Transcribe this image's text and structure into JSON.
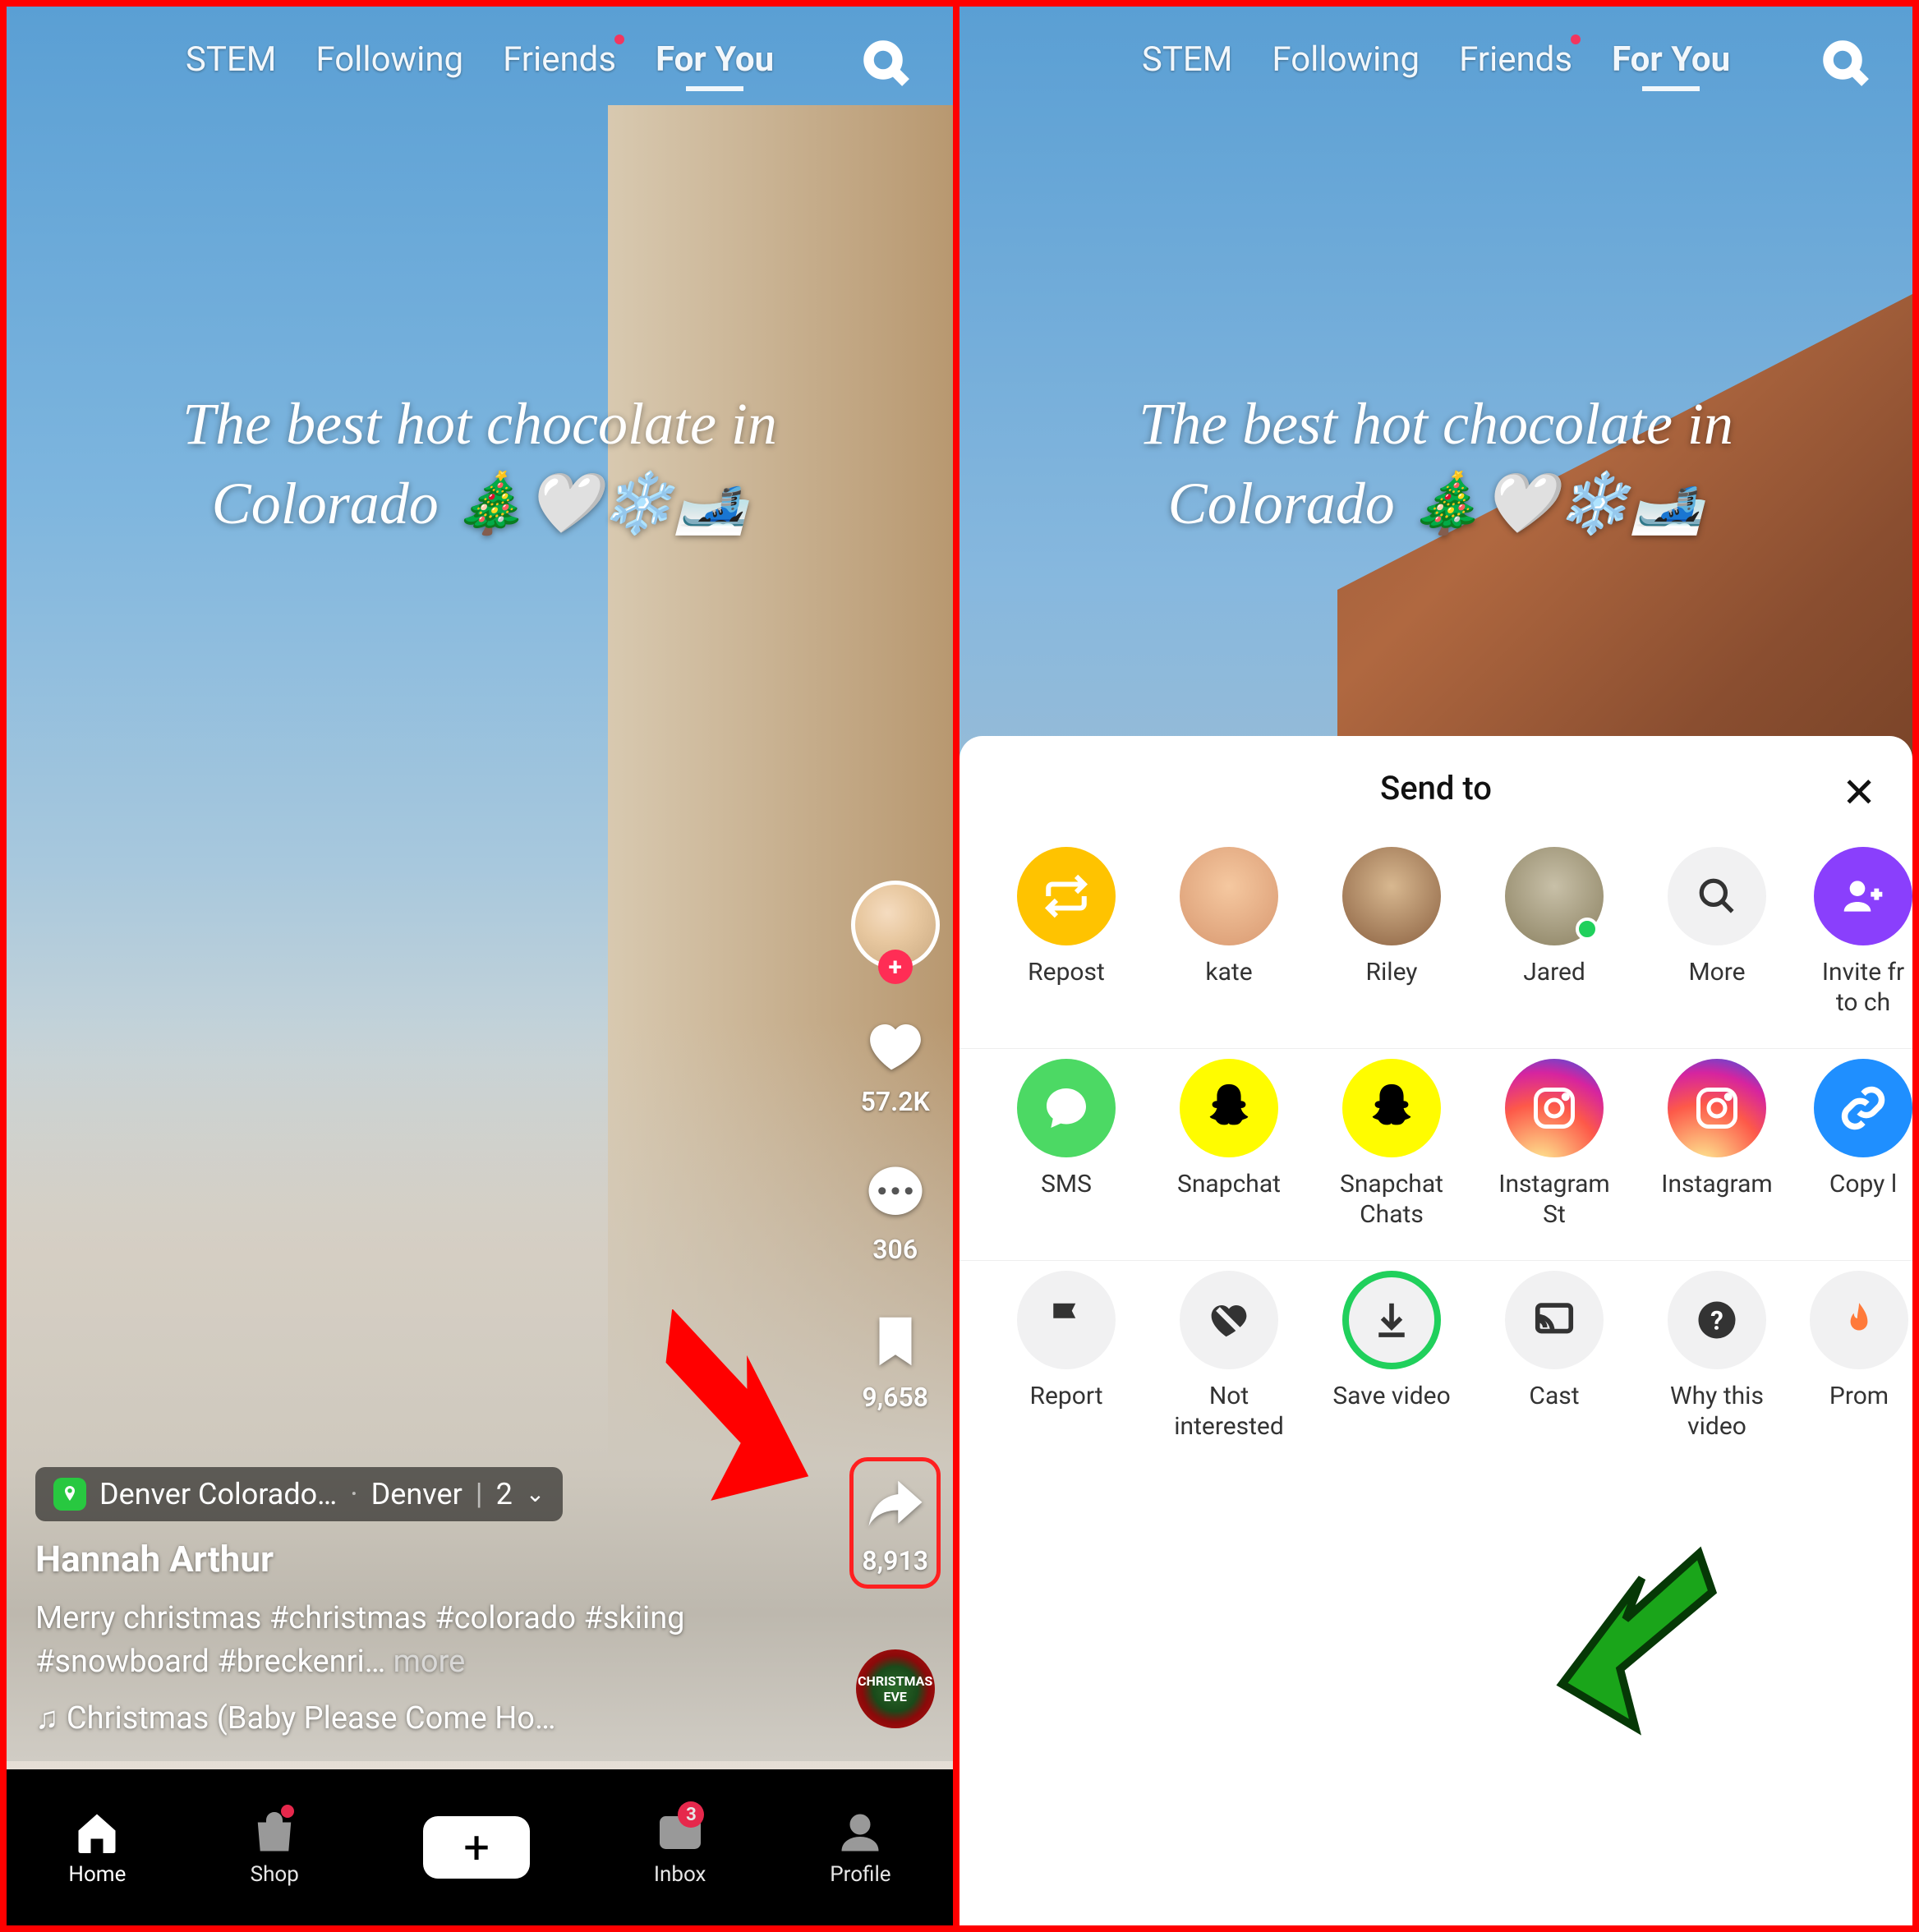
{
  "nav": {
    "tabs": [
      "STEM",
      "Following",
      "Friends",
      "For You"
    ],
    "active": "For You"
  },
  "overlay": {
    "title_line1": "The best hot chocolate in",
    "title_line2": "Colorado 🎄🤍❄️🎿"
  },
  "rail": {
    "likes": "57.2K",
    "comments": "306",
    "bookmarks": "9,658",
    "shares": "8,913",
    "album_text": "CHRISTMAS EVE"
  },
  "location": {
    "name": "Denver Colorado…",
    "city": "Denver",
    "count": "2"
  },
  "post": {
    "author": "Hannah Arthur",
    "caption": "Merry christmas #christmas #colorado #skiing #snowboard #breckenri…",
    "more": "more",
    "sound": "♫ Christmas (Baby Please Come Ho…"
  },
  "bottombar": {
    "home": "Home",
    "shop": "Shop",
    "inbox": "Inbox",
    "inbox_badge": "3",
    "profile": "Profile"
  },
  "sheet": {
    "title": "Send to",
    "contacts": [
      {
        "label": "Repost",
        "type": "repost"
      },
      {
        "label": "kate",
        "type": "avatar"
      },
      {
        "label": "Riley",
        "type": "avatar"
      },
      {
        "label": "Jared",
        "type": "avatar",
        "online": true
      },
      {
        "label": "More",
        "type": "more"
      },
      {
        "label": "Invite fr to ch",
        "type": "invite"
      }
    ],
    "apps": [
      {
        "label": "SMS",
        "type": "sms"
      },
      {
        "label": "Snapchat",
        "type": "snap"
      },
      {
        "label": "Snapchat Chats",
        "type": "snap"
      },
      {
        "label": "Instagram St",
        "type": "insta"
      },
      {
        "label": "Instagram",
        "type": "insta"
      },
      {
        "label": "Copy l",
        "type": "link"
      }
    ],
    "actions": [
      {
        "label": "Report",
        "type": "report"
      },
      {
        "label": "Not interested",
        "type": "notint"
      },
      {
        "label": "Save video",
        "type": "save",
        "highlight": true
      },
      {
        "label": "Cast",
        "type": "cast"
      },
      {
        "label": "Why this video",
        "type": "why"
      },
      {
        "label": "Prom",
        "type": "promote"
      }
    ]
  }
}
